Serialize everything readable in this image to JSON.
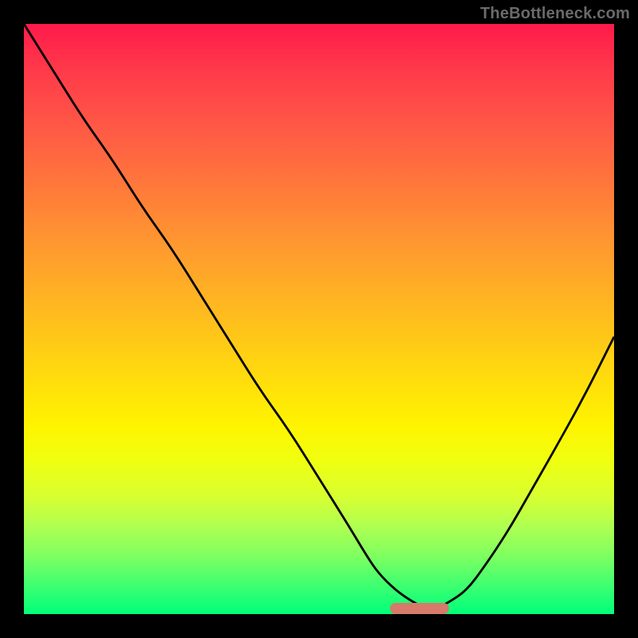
{
  "watermark": "TheBottleneck.com",
  "chart_data": {
    "type": "line",
    "title": "",
    "xlabel": "",
    "ylabel": "",
    "xlim": [
      0,
      100
    ],
    "ylim": [
      0,
      100
    ],
    "grid": false,
    "background_gradient": {
      "top_color": "#ff1a4a",
      "bottom_color": "#00ff7a"
    },
    "series": [
      {
        "name": "bottleneck-curve",
        "x": [
          0,
          5,
          10,
          15,
          20,
          25,
          30,
          35,
          40,
          45,
          50,
          55,
          58,
          60,
          63,
          66,
          68,
          70,
          72,
          75,
          78,
          82,
          86,
          90,
          95,
          100
        ],
        "values": [
          100,
          92,
          84,
          77,
          69,
          62,
          54,
          46,
          38,
          31,
          23,
          15,
          10,
          7,
          4,
          2,
          1,
          1,
          2,
          4,
          8,
          14,
          21,
          28,
          37,
          47
        ]
      }
    ],
    "annotations": [
      {
        "name": "optimal-zone-marker",
        "type": "segment",
        "x_start": 62,
        "x_end": 72,
        "y": 1,
        "color": "#d77a6a"
      }
    ]
  }
}
